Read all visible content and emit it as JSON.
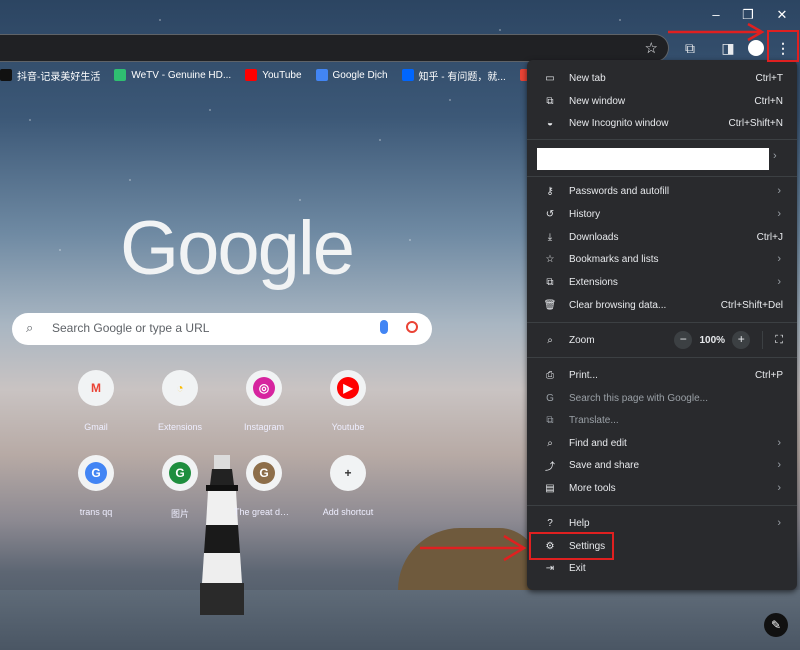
{
  "window": {
    "minimize_icon": "–",
    "restore_icon": "❐",
    "close_icon": "✕"
  },
  "bookmarks": [
    {
      "label": "抖音-记录美好生活",
      "color": "#111111"
    },
    {
      "label": "WeTV - Genuine HD...",
      "color": "#2fbf71"
    },
    {
      "label": "YouTube",
      "color": "#ff0000"
    },
    {
      "label": "Google Dịch",
      "color": "#4285f4"
    },
    {
      "label": "知乎 - 有问题，就...",
      "color": "#0066ff"
    },
    {
      "label": "Gmail",
      "color": "#ea4335"
    }
  ],
  "logo": "Google",
  "search": {
    "placeholder": "Search Google or type a URL"
  },
  "shortcuts": [
    {
      "label": "Gmail",
      "glyph": "M",
      "color": "#ea4335",
      "bg": "#f1f3f4"
    },
    {
      "label": "Extensions",
      "glyph": "◔",
      "color": "#fbbc04",
      "bg": "#f1f3f4"
    },
    {
      "label": "Instagram",
      "glyph": "◎",
      "color": "#ffffff",
      "bg": "#d6249f"
    },
    {
      "label": "Youtube",
      "glyph": "▶",
      "color": "#ffffff",
      "bg": "#ff0000"
    },
    {
      "label": "trans qq",
      "glyph": "G",
      "color": "#ffffff",
      "bg": "#4285f4"
    },
    {
      "label": "图片",
      "glyph": "G",
      "color": "#ffffff",
      "bg": "#1e8e3e"
    },
    {
      "label": "The great dat...",
      "glyph": "G",
      "color": "#ffffff",
      "bg": "#8d6e4a"
    },
    {
      "label": "Add shortcut",
      "glyph": "+",
      "color": "#333333",
      "bg": "#f1f3f4"
    }
  ],
  "menu": {
    "new_tab": {
      "label": "New tab",
      "shortcut": "Ctrl+T"
    },
    "new_window": {
      "label": "New window",
      "shortcut": "Ctrl+N"
    },
    "incognito": {
      "label": "New Incognito window",
      "shortcut": "Ctrl+Shift+N"
    },
    "passwords": {
      "label": "Passwords and autofill"
    },
    "history": {
      "label": "History"
    },
    "downloads": {
      "label": "Downloads",
      "shortcut": "Ctrl+J"
    },
    "bookmarks": {
      "label": "Bookmarks and lists"
    },
    "extensions": {
      "label": "Extensions"
    },
    "clear": {
      "label": "Clear browsing data...",
      "shortcut": "Ctrl+Shift+Del"
    },
    "zoom": {
      "label": "Zoom",
      "value": "100%",
      "minus": "−",
      "plus": "+"
    },
    "print": {
      "label": "Print...",
      "shortcut": "Ctrl+P"
    },
    "search_page": {
      "label": "Search this page with Google..."
    },
    "translate": {
      "label": "Translate..."
    },
    "find_edit": {
      "label": "Find and edit"
    },
    "save_share": {
      "label": "Save and share"
    },
    "more_tools": {
      "label": "More tools"
    },
    "help": {
      "label": "Help"
    },
    "settings": {
      "label": "Settings"
    },
    "exit": {
      "label": "Exit"
    }
  },
  "colors": {
    "highlight": "#e02020",
    "menu_bg": "#292a2d"
  }
}
